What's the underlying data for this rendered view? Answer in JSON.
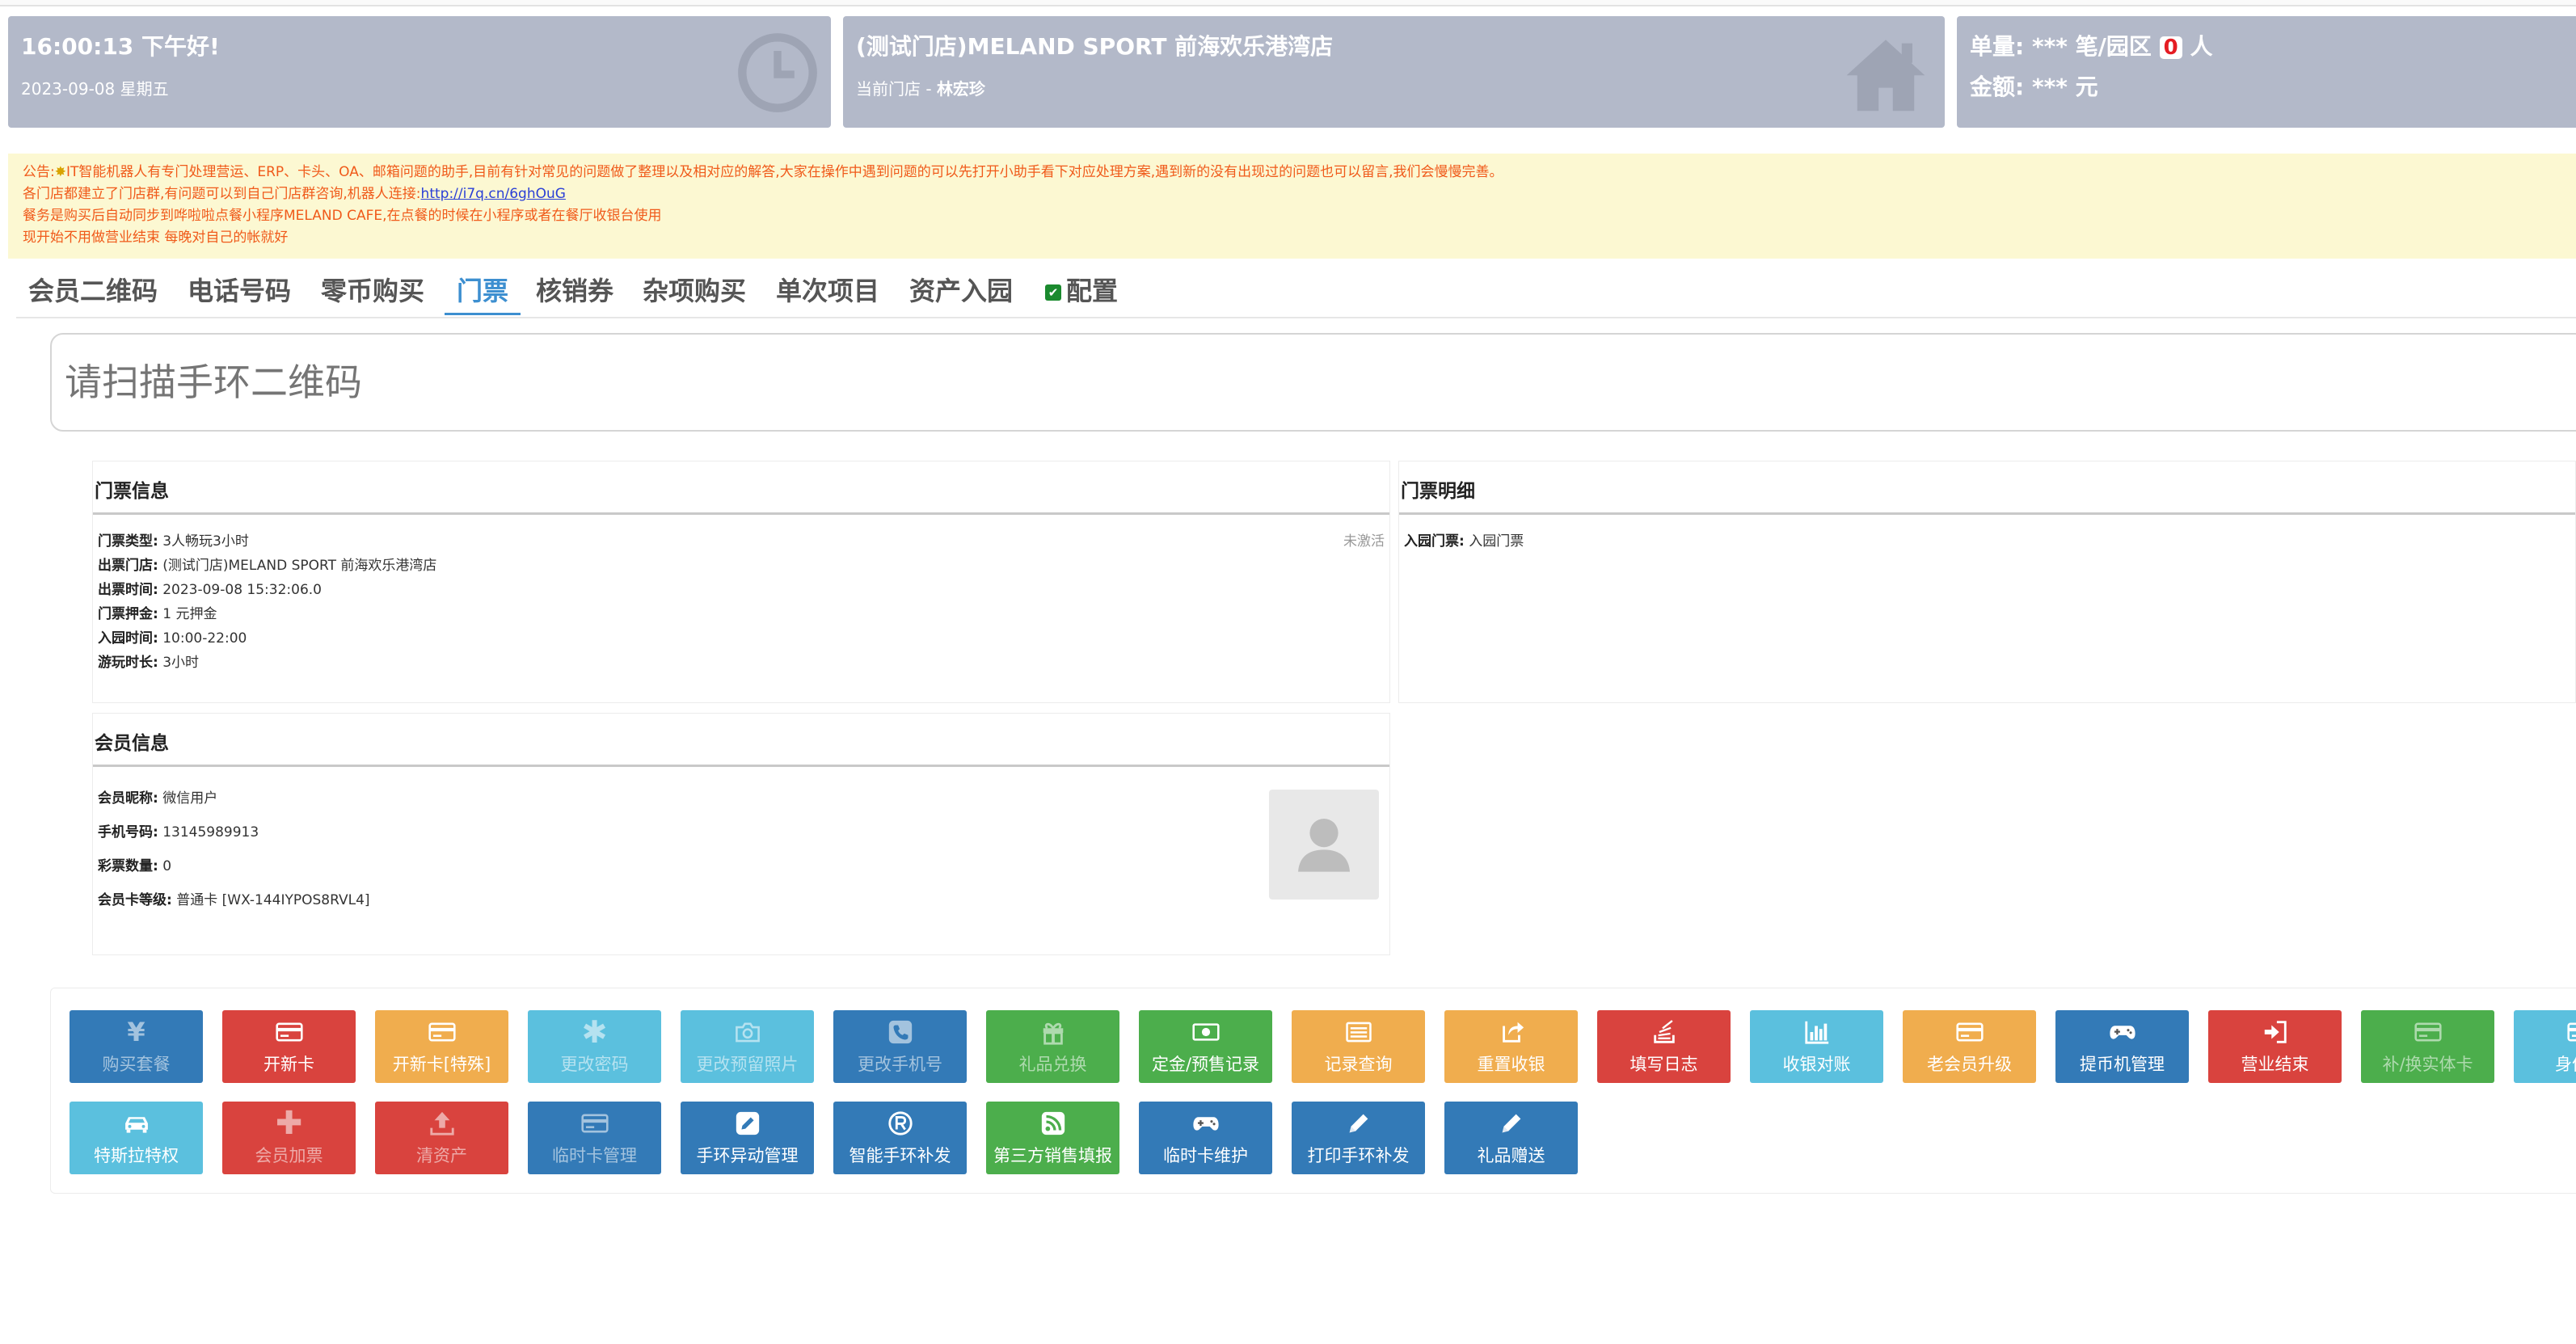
{
  "header": {
    "time_greeting": "16:00:13 下午好!",
    "date": "2023-09-08 星期五",
    "store_title": "(测试门店)MELAND SPORT 前海欢乐港湾店",
    "store_label": "当前门店 - ",
    "store_user": "林宏珍",
    "orders_prefix": "单量: *** 笔/园区",
    "orders_count": "0",
    "orders_suffix": "人",
    "amount": "金额: *** 元"
  },
  "notice": {
    "prefix": "公告:",
    "line1": "IT智能机器人有专门处理营运、ERP、卡头、OA、邮箱问题的助手,目前有针对常见的问题做了整理以及相对应的解答,大家在操作中遇到问题的可以先打开小助手看下对应处理方案,遇到新的没有出现过的问题也可以留言,我们会慢慢完善。",
    "line2": "各门店都建立了门店群,有问题可以到自己门店群咨询,机器人连接:",
    "link": "http://i7q.cn/6ghOuG",
    "line3": "餐务是购买后自动同步到哗啦啦点餐小程序MELAND CAFE,在点餐的时候在小程序或者在餐厅收银台使用",
    "line4": "现开始不用做营业结束 每晚对自己的帐就好"
  },
  "tabs": [
    {
      "label": "会员二维码"
    },
    {
      "label": "电话号码"
    },
    {
      "label": "零币购买"
    },
    {
      "label": "门票",
      "active": true
    },
    {
      "label": "核销券"
    },
    {
      "label": "杂项购买"
    },
    {
      "label": "单次项目"
    },
    {
      "label": "资产入园"
    },
    {
      "label": "配置"
    }
  ],
  "scan_input": {
    "placeholder": "请扫描手环二维码"
  },
  "ticket_info": {
    "title": "门票信息",
    "status": "未激活",
    "rows": [
      {
        "k": "门票类型:",
        "v": "3人畅玩3小时"
      },
      {
        "k": "出票门店:",
        "v": "(测试门店)MELAND SPORT 前海欢乐港湾店"
      },
      {
        "k": "出票时间:",
        "v": "2023-09-08 15:32:06.0"
      },
      {
        "k": "门票押金:",
        "v": "1 元押金"
      },
      {
        "k": "入园时间:",
        "v": "10:00-22:00"
      },
      {
        "k": "游玩时长:",
        "v": "3小时"
      }
    ]
  },
  "ticket_detail": {
    "title": "门票明细",
    "rows": [
      {
        "k": "入园门票:",
        "v": "入园门票"
      }
    ]
  },
  "member_info": {
    "title": "会员信息",
    "rows": [
      {
        "k": "会员昵称:",
        "v": "微信用户"
      },
      {
        "k": "手机号码:",
        "v": "13145989913"
      },
      {
        "k": "彩票数量:",
        "v": "0"
      },
      {
        "k": "会员卡等级:",
        "v": "普通卡 [WX-144IYPOS8RVL4]"
      }
    ]
  },
  "buttons_row1": [
    {
      "label": "购买套餐",
      "icon": "yen-icon",
      "color": "blue",
      "dim": true
    },
    {
      "label": "开新卡",
      "icon": "card-icon",
      "color": "red"
    },
    {
      "label": "开新卡[特殊]",
      "icon": "card-icon",
      "color": "orange"
    },
    {
      "label": "更改密码",
      "icon": "asterisk-icon",
      "color": "cyan",
      "dim": true
    },
    {
      "label": "更改预留照片",
      "icon": "camera-icon",
      "color": "cyan",
      "dim": true
    },
    {
      "label": "更改手机号",
      "icon": "phone-icon",
      "color": "blue",
      "dim": true
    },
    {
      "label": "礼品兑换",
      "icon": "gift-icon",
      "color": "green",
      "dim": true
    },
    {
      "label": "定金/预售记录",
      "icon": "money-icon",
      "color": "green"
    },
    {
      "label": "记录查询",
      "icon": "list-icon",
      "color": "orange"
    },
    {
      "label": "重置收银",
      "icon": "share-icon",
      "color": "orange"
    },
    {
      "label": "填写日志",
      "icon": "stack-icon",
      "color": "red"
    },
    {
      "label": "收银对账",
      "icon": "chart-icon",
      "color": "cyan"
    },
    {
      "label": "老会员升级",
      "icon": "card-icon",
      "color": "orange"
    },
    {
      "label": "提币机管理",
      "icon": "gamepad-icon",
      "color": "blue"
    },
    {
      "label": "营业结束",
      "icon": "signin-icon",
      "color": "red"
    },
    {
      "label": "补/换实体卡",
      "icon": "card-icon",
      "color": "green",
      "dim": true
    },
    {
      "label": "身份证",
      "icon": "card-icon",
      "color": "cyan"
    }
  ],
  "buttons_row2": [
    {
      "label": "特斯拉特权",
      "icon": "car-icon",
      "color": "cyan"
    },
    {
      "label": "会员加票",
      "icon": "plus-icon",
      "color": "red",
      "dim": true
    },
    {
      "label": "清资产",
      "icon": "upload-icon",
      "color": "red",
      "dim": true
    },
    {
      "label": "临时卡管理",
      "icon": "card-icon",
      "color": "blue",
      "dim": true
    },
    {
      "label": "手环异动管理",
      "icon": "edit-icon",
      "color": "blue"
    },
    {
      "label": "智能手环补发",
      "icon": "registered-icon",
      "color": "blue"
    },
    {
      "label": "第三方销售填报",
      "icon": "rss-icon",
      "color": "green"
    },
    {
      "label": "临时卡维护",
      "icon": "gamepad-icon",
      "color": "blue"
    },
    {
      "label": "打印手环补发",
      "icon": "pencil-icon",
      "color": "blue"
    },
    {
      "label": "礼品赠送",
      "icon": "pencil-icon",
      "color": "blue"
    }
  ]
}
